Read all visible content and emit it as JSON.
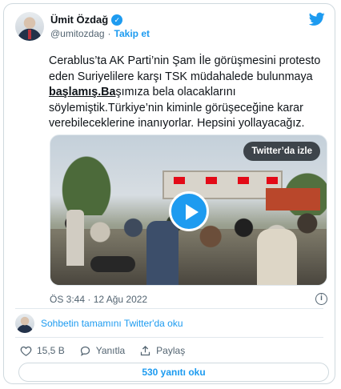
{
  "author": {
    "name": "Ümit Özdağ",
    "handle": "@umitozdag",
    "separator": "·",
    "follow_label": "Takip et"
  },
  "tweet": {
    "text_before": "Cerablus’ta AK Parti’nin Şam İle görüşmesini protesto eden Suriyelilere karşı TSK müdahalede bulunmaya ",
    "link_text": "başlamış.Ba",
    "text_after": "şımıza bela olacaklarını söylemiştik.Türkiye’nin kiminle görüşeceğine karar verebileceklerine inanıyorlar. Hepsini yollayacağız."
  },
  "video": {
    "watch_label": "Twitter’da izle"
  },
  "timestamp": "ÖS 3:44 · 12 Ağu 2022",
  "conversation_label": "Sohbetin tamamını Twitter'da oku",
  "actions": {
    "likes": "15,5 B",
    "reply_label": "Yanıtla",
    "share_label": "Paylaş"
  },
  "replies_button_label": "530 yanıtı oku",
  "colors": {
    "accent": "#1d9bf0",
    "like_red": "#f91880",
    "text_secondary": "#536471"
  }
}
